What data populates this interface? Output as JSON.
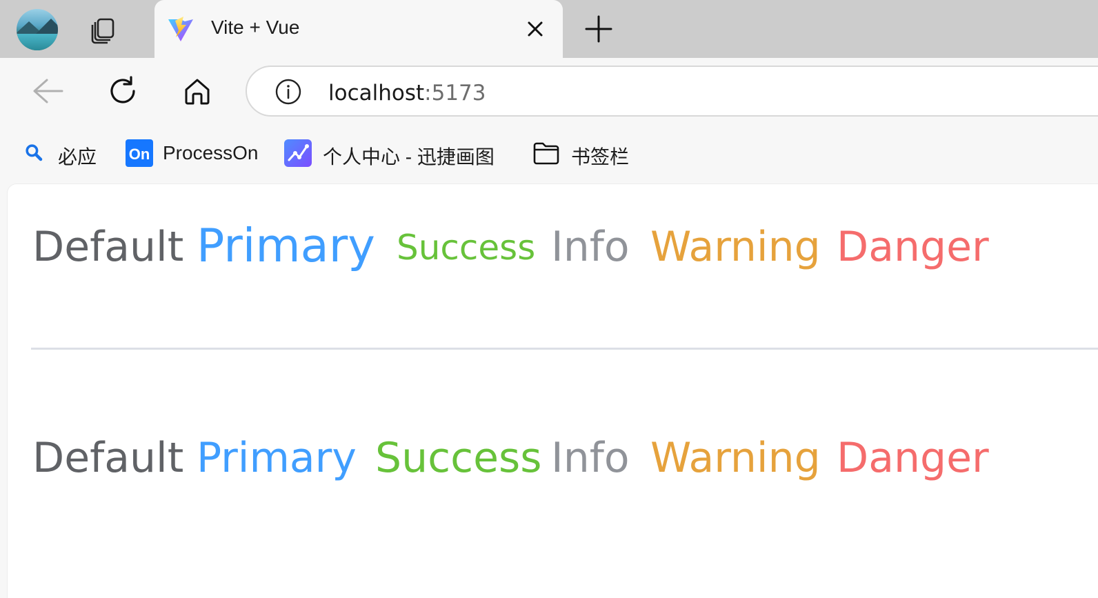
{
  "browser": {
    "tab": {
      "title": "Vite + Vue",
      "favicon": "vite-icon"
    },
    "address": {
      "host": "localhost",
      "port": ":5173"
    },
    "bookmarks": [
      {
        "label": "必应",
        "icon": "search-icon"
      },
      {
        "label": "ProcessOn",
        "icon": "processon-icon"
      },
      {
        "label": "个人中心 - 迅捷画图",
        "icon": "chart-app-icon"
      },
      {
        "label": "书签栏",
        "icon": "folder-icon"
      }
    ]
  },
  "colors": {
    "default": "#606266",
    "primary": "#409eff",
    "success": "#67c23a",
    "info": "#909399",
    "warning": "#e6a23c",
    "danger": "#f56c6c"
  },
  "rows": [
    {
      "items": [
        {
          "label": "Default",
          "color": "#606266"
        },
        {
          "label": "Primary",
          "color": "#409eff"
        },
        {
          "label": "Success",
          "color": "#67c23a"
        },
        {
          "label": "Info",
          "color": "#909399"
        },
        {
          "label": "Warning",
          "color": "#e6a23c"
        },
        {
          "label": "Danger",
          "color": "#f56c6c"
        }
      ]
    },
    {
      "items": [
        {
          "label": "Default",
          "color": "#606266"
        },
        {
          "label": "Primary",
          "color": "#409eff"
        },
        {
          "label": "Success",
          "color": "#67c23a"
        },
        {
          "label": "Info",
          "color": "#909399"
        },
        {
          "label": "Warning",
          "color": "#e6a23c"
        },
        {
          "label": "Danger",
          "color": "#f56c6c"
        }
      ]
    }
  ]
}
